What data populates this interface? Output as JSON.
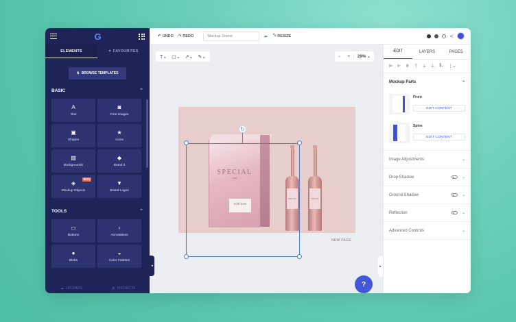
{
  "sidebar": {
    "tabs": [
      {
        "label": "ELEMENTS"
      },
      {
        "label": "FAVOURITES"
      }
    ],
    "browse_label": "BROWSE TEMPLATES",
    "basic": {
      "title": "BASIC",
      "items": [
        {
          "label": "Text",
          "icon": "text-icon"
        },
        {
          "label": "Free Images",
          "icon": "camera-icon"
        },
        {
          "label": "Shapes",
          "icon": "shapes-icon"
        },
        {
          "label": "Icons",
          "icon": "star-icon"
        },
        {
          "label": "Backgrounds",
          "icon": "pattern-icon"
        },
        {
          "label": "Brand It",
          "icon": "tag-icon"
        },
        {
          "label": "Mockup Objects",
          "icon": "cube-icon",
          "badge": "BETA"
        },
        {
          "label": "Brand Logos",
          "icon": "logo-icon"
        }
      ]
    },
    "tools": {
      "title": "TOOLS",
      "items": [
        {
          "label": "Buttons",
          "icon": "button-icon"
        },
        {
          "label": "Annotations",
          "icon": "arrow-left-icon"
        },
        {
          "label": "Blobs",
          "icon": "blob-icon"
        },
        {
          "label": "Color Palettes",
          "icon": "palette-icon"
        }
      ]
    },
    "bottom": [
      {
        "label": "UPLOADS"
      },
      {
        "label": "PROJECTS"
      }
    ]
  },
  "topbar": {
    "undo": "UNDO",
    "redo": "REDO",
    "scene_placeholder": "Mockup Scene",
    "resize": "RESIZE"
  },
  "canvas": {
    "zoom": "29%",
    "new_page": "NEW PAGE",
    "box_title": "SPECIAL",
    "box_sub": "rosé",
    "box_signature": "with love",
    "bottle_label": "SPECIAL"
  },
  "help": "?",
  "right_panel": {
    "tabs": [
      {
        "label": "EDIT"
      },
      {
        "label": "LAYERS"
      },
      {
        "label": "PAGES"
      }
    ],
    "mockup_parts": {
      "title": "Mockup Parts",
      "parts": [
        {
          "name": "Front",
          "button": "EDIT CONTENT"
        },
        {
          "name": "Spine",
          "button": "EDIT CONTENT"
        }
      ]
    },
    "sections": [
      {
        "label": "Image Adjustments",
        "toggle": false
      },
      {
        "label": "Drop Shadow",
        "toggle": true
      },
      {
        "label": "Ground Shadow",
        "toggle": true
      },
      {
        "label": "Reflection",
        "toggle": true
      },
      {
        "label": "Advanced Controls",
        "toggle": false
      }
    ]
  },
  "colors": {
    "sidebar": "#1e2458",
    "accent": "#3e52d4",
    "artboard": "#e8cdcd"
  }
}
